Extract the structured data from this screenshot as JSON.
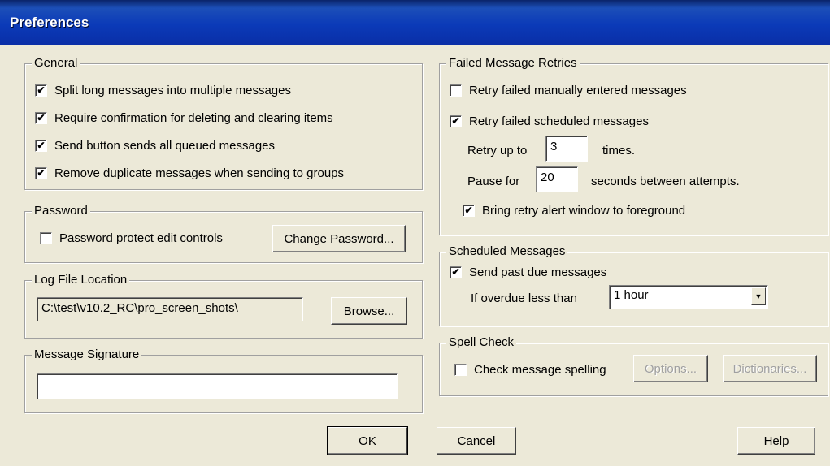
{
  "window": {
    "title": "Preferences"
  },
  "general": {
    "label": "General",
    "options": [
      {
        "label": "Split long messages into multiple messages",
        "checked": true
      },
      {
        "label": "Require confirmation for deleting and clearing items",
        "checked": true
      },
      {
        "label": "Send button sends all queued messages",
        "checked": true
      },
      {
        "label": "Remove duplicate messages when sending to groups",
        "checked": true
      }
    ]
  },
  "password": {
    "label": "Password",
    "protect_label": "Password protect edit controls",
    "protect_checked": false,
    "change_button": "Change Password..."
  },
  "log_file": {
    "label": "Log File Location",
    "path": "C:\\test\\v10.2_RC\\pro_screen_shots\\",
    "browse_button": "Browse..."
  },
  "signature": {
    "label": "Message Signature",
    "value": ""
  },
  "retries": {
    "label": "Failed Message Retries",
    "manual_label": "Retry failed manually entered messages",
    "manual_checked": false,
    "scheduled_label": "Retry failed scheduled messages",
    "scheduled_checked": true,
    "retry_prefix": "Retry up to",
    "retry_count": "3",
    "retry_suffix": "times.",
    "pause_prefix": "Pause for",
    "pause_seconds": "20",
    "pause_suffix": "seconds between attempts.",
    "foreground_label": "Bring retry alert window to foreground",
    "foreground_checked": true
  },
  "scheduled": {
    "label": "Scheduled Messages",
    "past_due_label": "Send past due messages",
    "past_due_checked": true,
    "overdue_label": "If overdue less than",
    "overdue_value": "1 hour"
  },
  "spell": {
    "label": "Spell Check",
    "check_label": "Check message spelling",
    "check_checked": false,
    "options_button": "Options...",
    "dictionaries_button": "Dictionaries..."
  },
  "footer": {
    "ok": "OK",
    "cancel": "Cancel",
    "help": "Help"
  },
  "glyphs": {
    "check": "✔",
    "dropdown": "▼"
  }
}
